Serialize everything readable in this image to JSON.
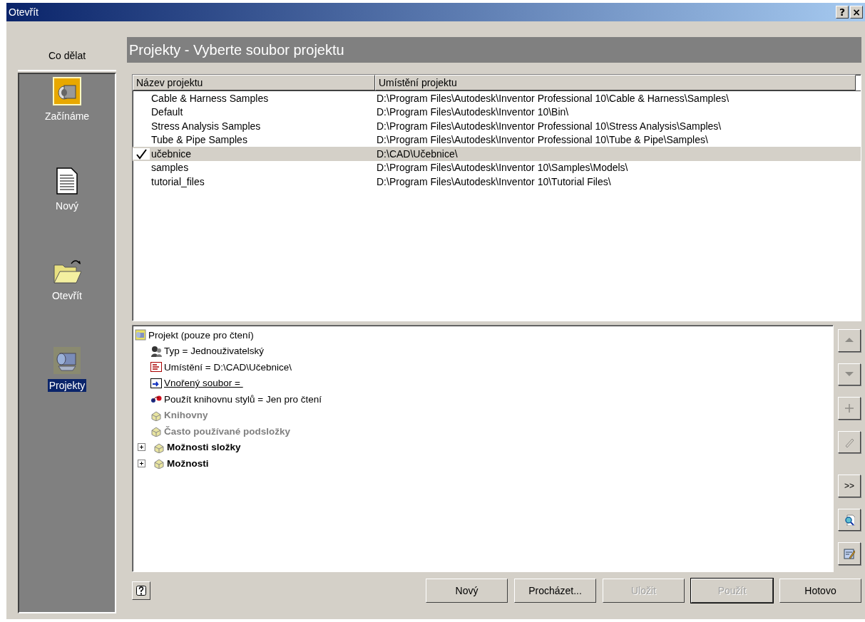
{
  "window": {
    "title": "Otevřít",
    "controls": [
      "?",
      "×"
    ]
  },
  "sidebar": {
    "heading": "Co dělat",
    "items": [
      {
        "kind": "start",
        "label": "Začínáme",
        "selected": false
      },
      {
        "kind": "new",
        "label": "Nový",
        "selected": false
      },
      {
        "kind": "open",
        "label": "Otevřít",
        "selected": false
      },
      {
        "kind": "projects",
        "label": "Projekty",
        "selected": true
      }
    ]
  },
  "header": "Projekty - Vyberte soubor projektu",
  "table": {
    "columns": [
      "Název projektu",
      "Umístění projektu"
    ],
    "rows": [
      {
        "name": "Cable & Harness Samples",
        "location": "D:\\Program Files\\Autodesk\\Inventor Professional 10\\Cable & Harness\\Samples\\",
        "checked": false,
        "selected": false
      },
      {
        "name": "Default",
        "location": "D:\\Program Files\\Autodesk\\Inventor 10\\Bin\\",
        "checked": false,
        "selected": false
      },
      {
        "name": "Stress Analysis Samples",
        "location": "D:\\Program Files\\Autodesk\\Inventor Professional 10\\Stress Analysis\\Samples\\",
        "checked": false,
        "selected": false
      },
      {
        "name": "Tube & Pipe Samples",
        "location": "D:\\Program Files\\Autodesk\\Inventor Professional 10\\Tube & Pipe\\Samples\\",
        "checked": false,
        "selected": false
      },
      {
        "name": "učebnice",
        "location": "D:\\CAD\\Učebnice\\",
        "checked": true,
        "selected": true
      },
      {
        "name": "samples",
        "location": "D:\\Program Files\\Autodesk\\Inventor 10\\Samples\\Models\\",
        "checked": false,
        "selected": false
      },
      {
        "name": "tutorial_files",
        "location": "D:\\Program Files\\Autodesk\\Inventor 10\\Tutorial Files\\",
        "checked": false,
        "selected": false
      }
    ]
  },
  "tree": {
    "kind": "root",
    "label": "Projekt (pouze pro čtení)",
    "children": [
      {
        "kind": "user-type",
        "label": "Typ = Jednouživatelský",
        "disabled": false
      },
      {
        "kind": "location",
        "label": "Umístění = D:\\CAD\\Učebnice\\",
        "disabled": false
      },
      {
        "kind": "nested-file",
        "label": "Vnořený soubor = ",
        "disabled": false
      },
      {
        "kind": "style-library",
        "label": "Použít knihovnu stylů = Jen pro čtení",
        "disabled": false
      },
      {
        "kind": "group",
        "label": "Knihovny",
        "disabled": true
      },
      {
        "kind": "group",
        "label": "Často používané podsložky",
        "disabled": true
      },
      {
        "kind": "group",
        "label": "Možnosti složky",
        "disabled": false,
        "expanded": false
      },
      {
        "kind": "group",
        "label": "Možnosti",
        "disabled": false,
        "expanded": false
      }
    ]
  },
  "side_tools": [
    {
      "kind": "up",
      "disabled": true
    },
    {
      "kind": "down",
      "disabled": true
    },
    {
      "kind": "add",
      "disabled": true
    },
    {
      "kind": "edit",
      "disabled": true
    },
    {
      "kind": "more",
      "label": ">>",
      "disabled": false
    },
    {
      "kind": "find",
      "disabled": false
    },
    {
      "kind": "edit-file",
      "disabled": false
    }
  ],
  "buttons": [
    {
      "label": "Nový",
      "disabled": false,
      "default": false
    },
    {
      "label": "Procházet...",
      "disabled": false,
      "default": false
    },
    {
      "label": "Uložit",
      "disabled": true,
      "default": false
    },
    {
      "label": "Použít",
      "disabled": true,
      "default": true
    },
    {
      "label": "Hotovo",
      "disabled": false,
      "default": false
    }
  ]
}
